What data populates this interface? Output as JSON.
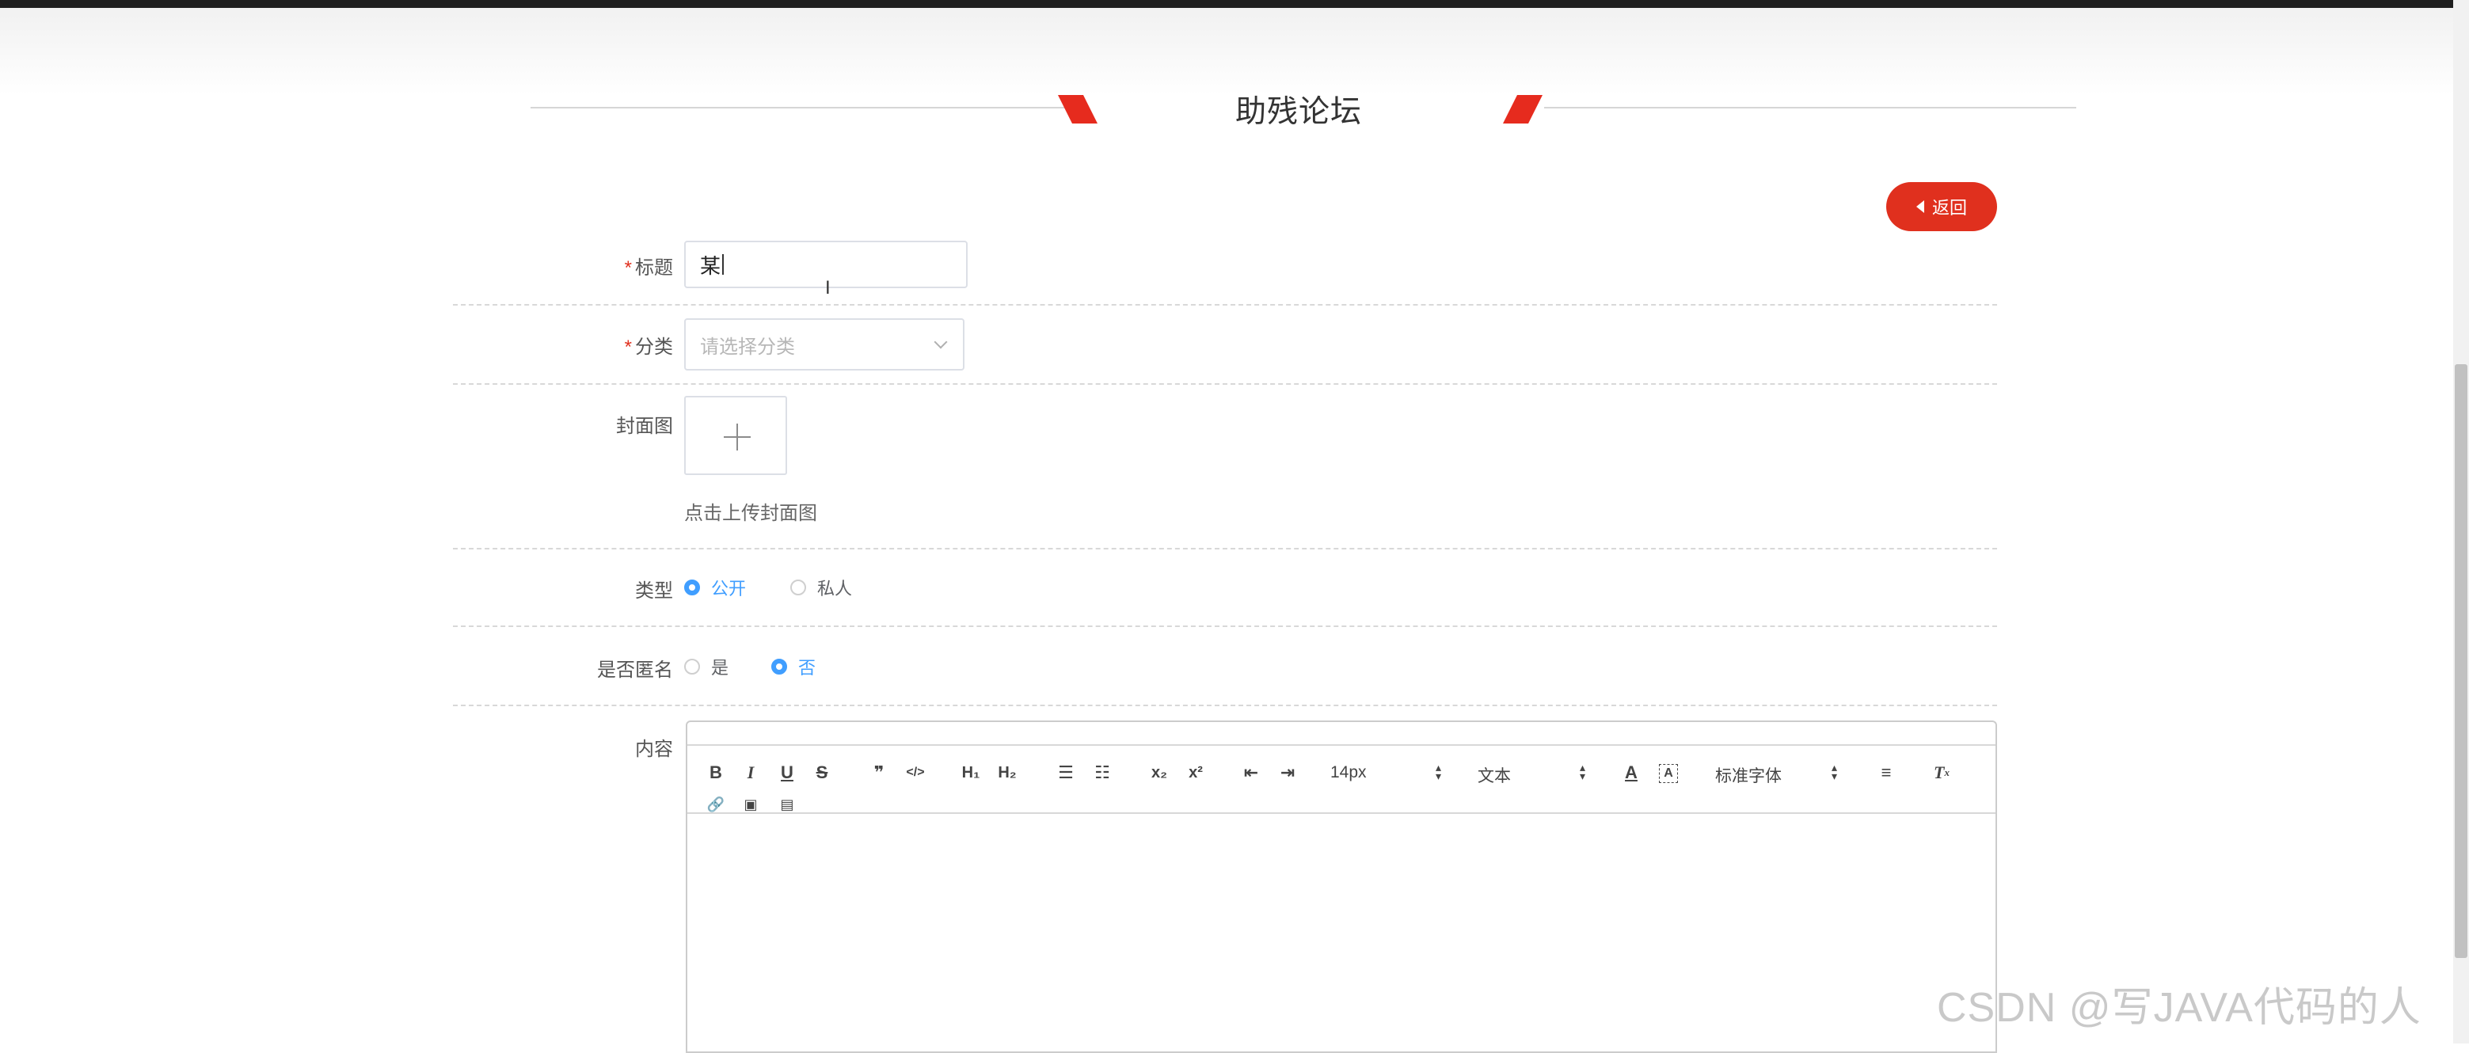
{
  "header": {
    "title": "助残论坛"
  },
  "back_button": {
    "label": "返回"
  },
  "form": {
    "title": {
      "label": "标题",
      "value": "某"
    },
    "category": {
      "label": "分类",
      "placeholder": "请选择分类"
    },
    "cover": {
      "label": "封面图",
      "hint": "点击上传封面图"
    },
    "type": {
      "label": "类型",
      "options": [
        "公开",
        "私人"
      ],
      "selected": "公开"
    },
    "anonymous": {
      "label": "是否匿名",
      "options": [
        "是",
        "否"
      ],
      "selected": "否"
    },
    "content": {
      "label": "内容"
    }
  },
  "editor_toolbar": {
    "font_size": "14px",
    "header_picker": "文本",
    "font_family": "标准字体",
    "icons": [
      "bold-icon",
      "italic-icon",
      "underline-icon",
      "strike-icon",
      "blockquote-icon",
      "code-block-icon",
      "h1-icon",
      "h2-icon",
      "ordered-list-icon",
      "bullet-list-icon",
      "subscript-icon",
      "superscript-icon",
      "outdent-icon",
      "indent-icon",
      "font-color-icon",
      "background-color-icon",
      "align-icon",
      "clean-format-icon",
      "link-icon",
      "image-icon",
      "video-icon"
    ]
  },
  "watermark": "CSDN @写JAVA代码的人",
  "colors": {
    "accent": "#e0301e",
    "primary": "#409eff"
  }
}
